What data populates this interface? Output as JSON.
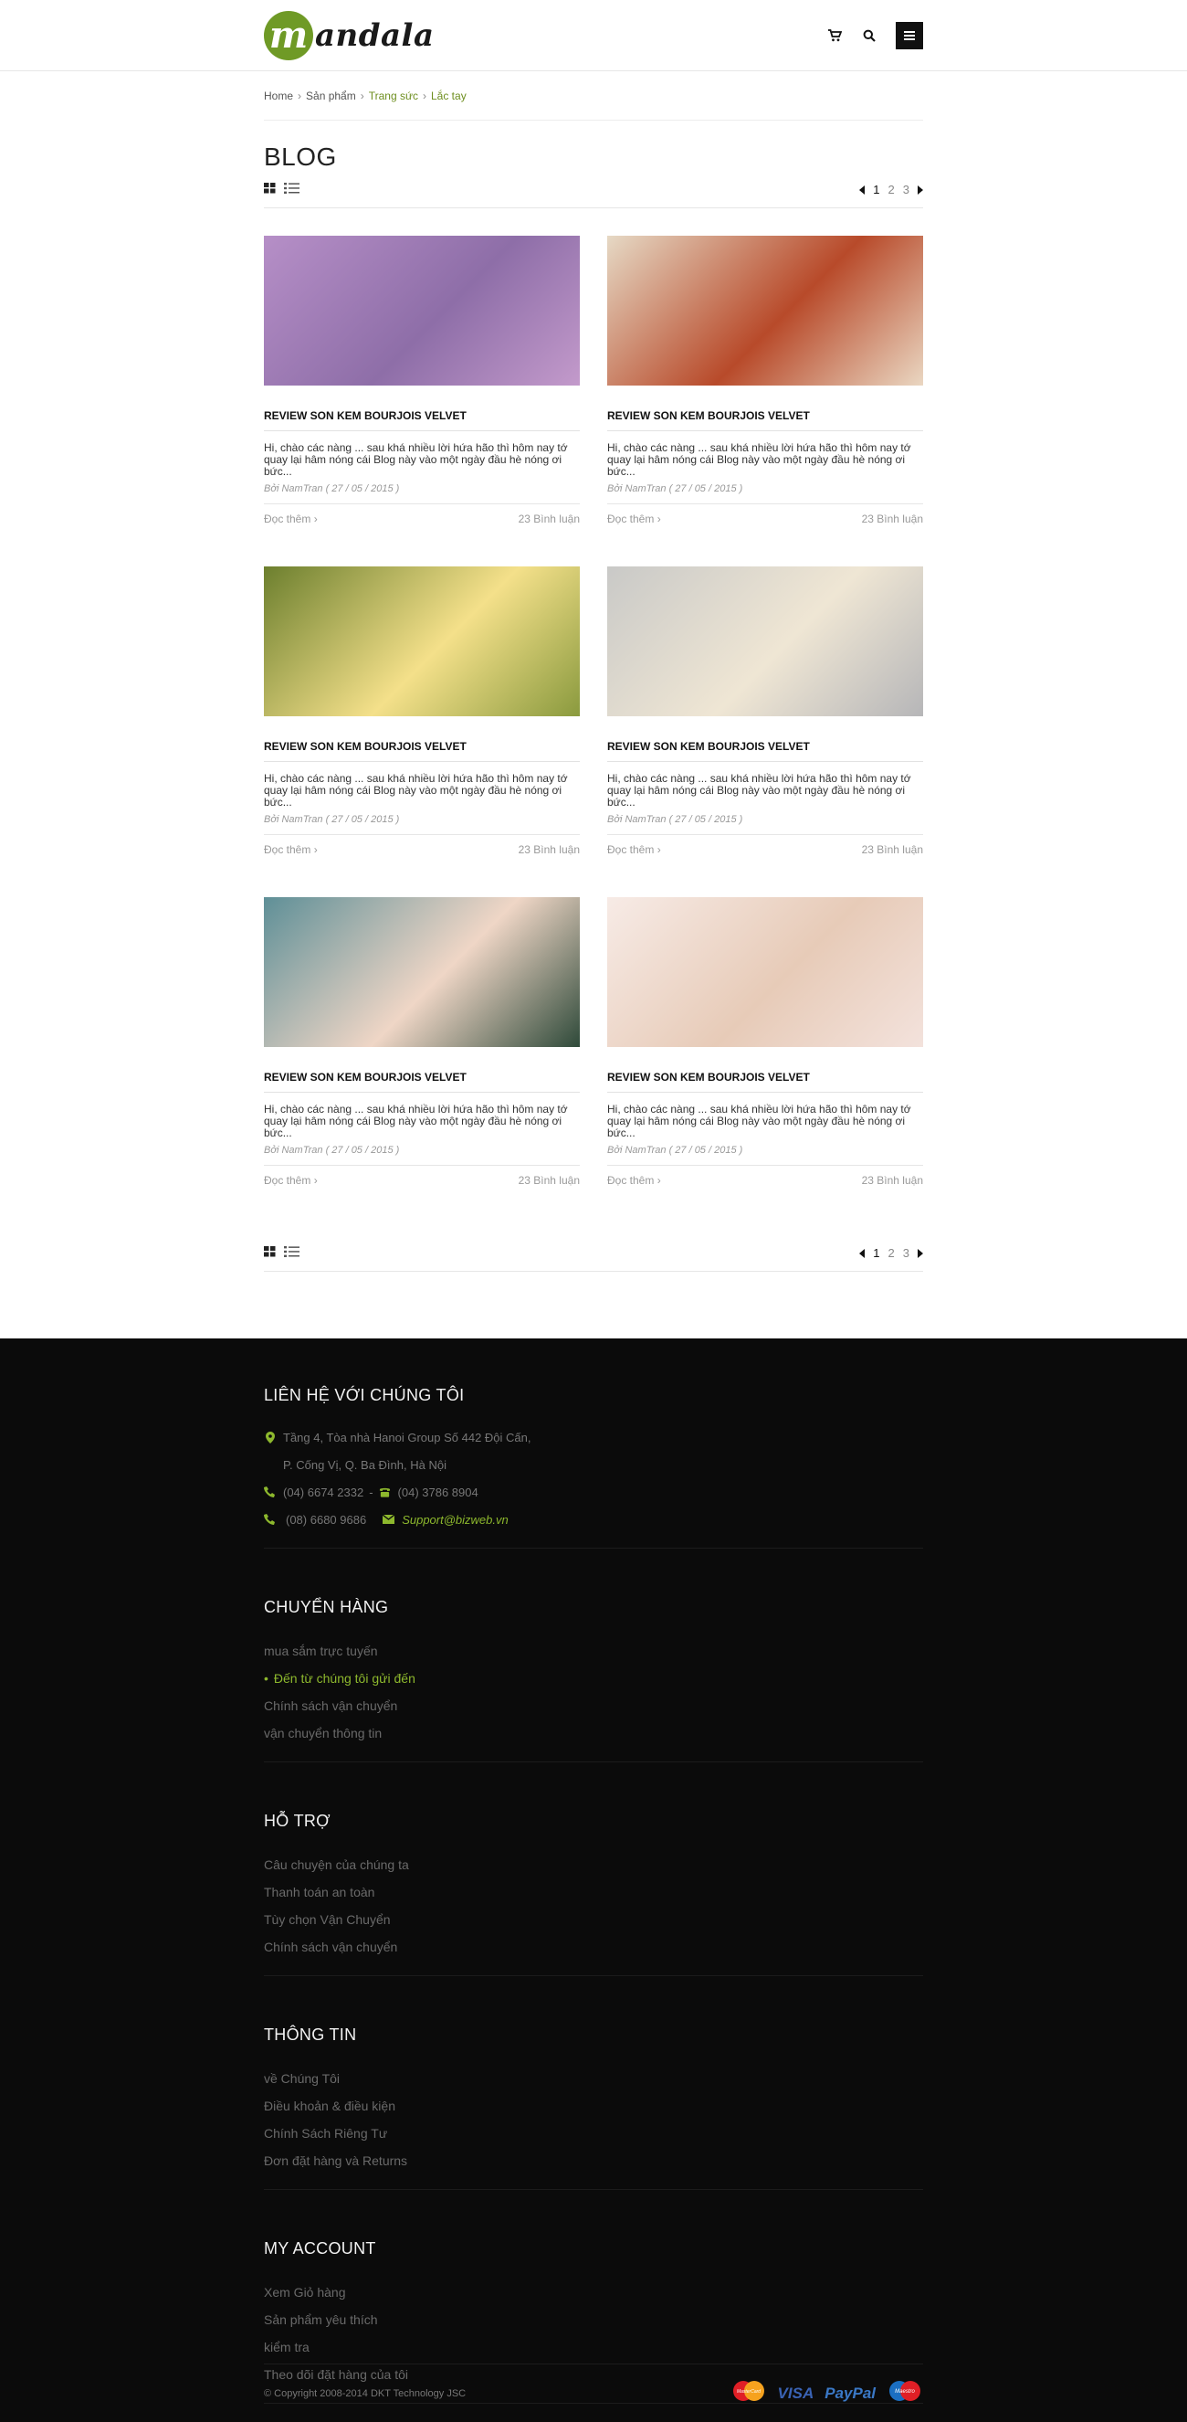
{
  "header": {
    "logo_letter": "m",
    "logo_text": "andala"
  },
  "breadcrumb": [
    "Home",
    "Sản phẩm",
    "Trang sức",
    "Lắc tay"
  ],
  "page_title": "BLOG",
  "pagination": {
    "pages": [
      "1",
      "2",
      "3"
    ],
    "active": "1"
  },
  "posts": [
    {
      "title": "REVIEW SON KEM BOURJOIS VELVET",
      "excerpt": "Hi, chào các nàng ... sau khá nhiều lời hứa hão thì hôm nay tớ quay lại hâm nóng cái Blog này vào một ngày đầu hè nóng ơi bức...",
      "byline": "Bởi NamTran ( 27 / 05 / 2015 )",
      "read_more": "Đọc thêm",
      "comments": "23 Bình luận",
      "image_colors": [
        "#b68fc7",
        "#8e6ea8",
        "#c39acb"
      ]
    },
    {
      "title": "REVIEW SON KEM BOURJOIS VELVET",
      "excerpt": "Hi, chào các nàng ... sau khá nhiều lời hứa hão thì hôm nay tớ quay lại hâm nóng cái Blog này vào một ngày đầu hè nóng ơi bức...",
      "byline": "Bởi NamTran ( 27 / 05 / 2015 )",
      "read_more": "Đọc thêm",
      "comments": "23 Bình luận",
      "image_colors": [
        "#e6d9c5",
        "#b84a2a",
        "#ead7c2"
      ]
    },
    {
      "title": "REVIEW SON KEM BOURJOIS VELVET",
      "excerpt": "Hi, chào các nàng ... sau khá nhiều lời hứa hão thì hôm nay tớ quay lại hâm nóng cái Blog này vào một ngày đầu hè nóng ơi bức...",
      "byline": "Bởi NamTran ( 27 / 05 / 2015 )",
      "read_more": "Đọc thêm",
      "comments": "23 Bình luận",
      "image_colors": [
        "#6c7f2e",
        "#f4e08a",
        "#8a9a3e"
      ]
    },
    {
      "title": "REVIEW SON KEM BOURJOIS VELVET",
      "excerpt": "Hi, chào các nàng ... sau khá nhiều lời hứa hão thì hôm nay tớ quay lại hâm nóng cái Blog này vào một ngày đầu hè nóng ơi bức...",
      "byline": "Bởi NamTran ( 27 / 05 / 2015 )",
      "read_more": "Đọc thêm",
      "comments": "23 Bình luận",
      "image_colors": [
        "#c9c9c7",
        "#efe6d4",
        "#b6b6b8"
      ]
    },
    {
      "title": "REVIEW SON KEM BOURJOIS VELVET",
      "excerpt": "Hi, chào các nàng ... sau khá nhiều lời hứa hão thì hôm nay tớ quay lại hâm nóng cái Blog này vào một ngày đầu hè nóng ơi bức...",
      "byline": "Bởi NamTran ( 27 / 05 / 2015 )",
      "read_more": "Đọc thêm",
      "comments": "23 Bình luận",
      "image_colors": [
        "#5e8f97",
        "#efd6c6",
        "#2f4a3a"
      ]
    },
    {
      "title": "REVIEW SON KEM BOURJOIS VELVET",
      "excerpt": "Hi, chào các nàng ... sau khá nhiều lời hứa hão thì hôm nay tớ quay lại hâm nóng cái Blog này vào một ngày đầu hè nóng ơi bức...",
      "byline": "Bởi NamTran ( 27 / 05 / 2015 )",
      "read_more": "Đọc thêm",
      "comments": "23 Bình luận",
      "image_colors": [
        "#f7ebe6",
        "#e7cbb8",
        "#f3e2dc"
      ]
    }
  ],
  "footer": {
    "contact": {
      "title": "LIÊN HỆ VỚI CHÚNG TÔI",
      "address_line1": "Tầng 4, Tòa nhà Hanoi Group  Số 442 Đội Cấn,",
      "address_line2": "P. Cống Vị, Q. Ba Đình, Hà Nội",
      "phone1": "(04) 6674 2332",
      "separator": "-",
      "phone2": "(04) 3786 8904",
      "phone3": "(08) 6680 9686",
      "email": "Support@bizweb.vn"
    },
    "sections": [
      {
        "title": "CHUYỂN HÀNG",
        "links": [
          "mua sắm trực tuyến",
          "Đến từ chúng tôi gửi đến",
          "Chính sách vận chuyển",
          "vận chuyển thông tin"
        ],
        "active_index": 1
      },
      {
        "title": "HỖ TRỢ",
        "links": [
          "Câu chuyện của chúng ta",
          "Thanh toán an toàn",
          "Tùy chọn Vận Chuyển",
          "Chính sách vận chuyển"
        ],
        "active_index": -1
      },
      {
        "title": "THÔNG TIN",
        "links": [
          "về Chúng Tôi",
          "Điều khoản & điều kiện",
          "Chính Sách Riêng Tư",
          "Đơn đặt hàng và Returns"
        ],
        "active_index": -1
      },
      {
        "title": "MY ACCOUNT",
        "links": [
          "Xem Giỏ hàng",
          "Sản phẩm yêu thích",
          "kiểm tra",
          "Theo dõi đặt hàng của tôi"
        ],
        "active_index": -1
      }
    ],
    "copyright": "© Copyright 2008-2014 DKT Technology JSC",
    "payments": {
      "visa": "VISA",
      "paypal": "PayPal",
      "mastercard_text": "MasterCard",
      "maestro_text": "Maestro"
    }
  },
  "colors": {
    "accent": "#8db82d",
    "brand_green": "#6f9a26",
    "footer_bg": "#0b0b0b"
  }
}
